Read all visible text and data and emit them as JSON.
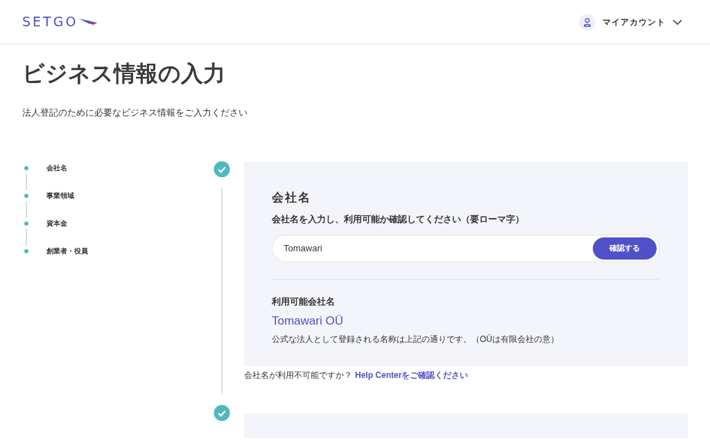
{
  "header": {
    "logo": "SETGO",
    "account": {
      "label": "マイアカウント"
    }
  },
  "page": {
    "title": "ビジネス情報の入力",
    "subtitle": "法人登記のために必要なビジネス情報をご入力ください"
  },
  "steps": [
    {
      "label": "会社名"
    },
    {
      "label": "事業領域"
    },
    {
      "label": "資本金"
    },
    {
      "label": "創業者・役員"
    }
  ],
  "company_card": {
    "heading": "会社名",
    "field_label": "会社名を入力し、利用可能か確認してください（要ローマ字）",
    "input": {
      "value": "Tomawari"
    },
    "check_button": "確認する",
    "available_label": "利用可能会社名",
    "available_name": "Tomawari OÜ",
    "note": "公式な法人として登録される名称は上記の通りです。（OÜは有限会社の意）"
  },
  "help": {
    "question": "会社名が利用不可能ですか？",
    "link": "Help Centerをご確認ください"
  }
}
